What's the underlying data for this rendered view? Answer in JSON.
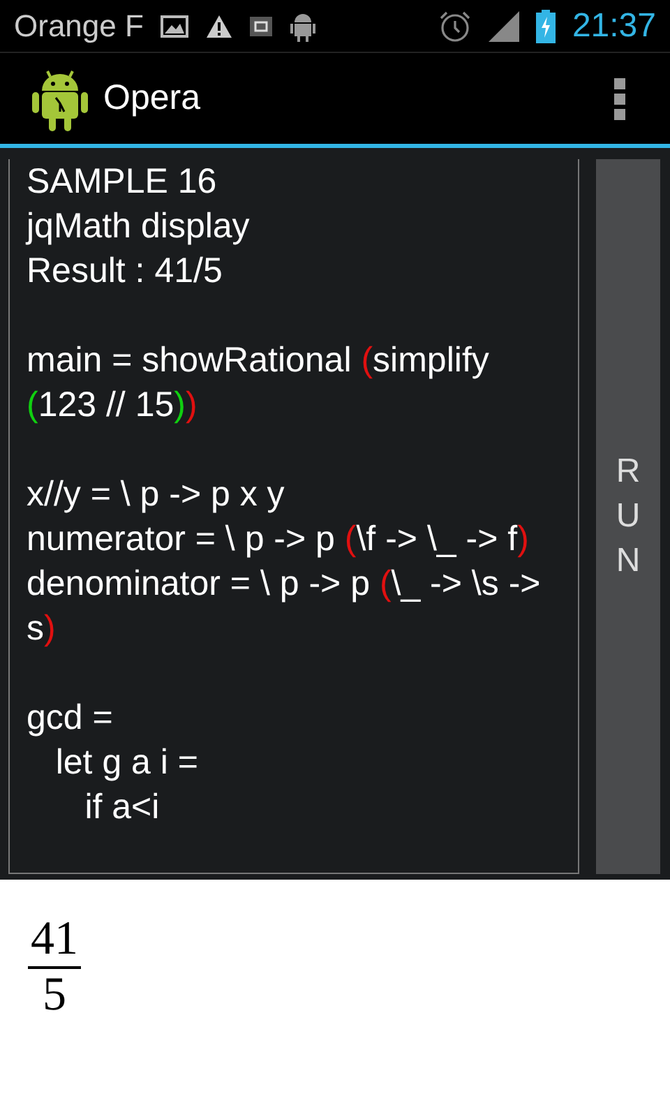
{
  "status_bar": {
    "carrier": "Orange F",
    "time": "21:37"
  },
  "action_bar": {
    "title": "Opera"
  },
  "editor": {
    "blocks": [
      [
        [
          {
            "text": "SAMPLE 16"
          }
        ],
        [
          {
            "text": "jqMath display"
          }
        ],
        [
          {
            "text": "Result : 41/5"
          }
        ]
      ],
      [
        [
          {
            "text": "main = showRational "
          },
          {
            "text": "(",
            "color": "#e01010"
          },
          {
            "text": "simplify "
          },
          {
            "text": "(",
            "color": "#10d010"
          },
          {
            "text": "123 // 15"
          },
          {
            "text": ")",
            "color": "#10d010"
          },
          {
            "text": ")",
            "color": "#e01010"
          }
        ]
      ],
      [
        [
          {
            "text": "x//y = \\ p -> p x y"
          }
        ],
        [
          {
            "text": "numerator = \\ p -> p "
          },
          {
            "text": "(",
            "color": "#e01010"
          },
          {
            "text": "\\f -> \\_ -> f"
          },
          {
            "text": ")",
            "color": "#e01010"
          }
        ],
        [
          {
            "text": "denominator = \\ p -> p "
          },
          {
            "text": "(",
            "color": "#e01010"
          },
          {
            "text": "\\_ -> \\s -> s"
          },
          {
            "text": ")",
            "color": "#e01010"
          }
        ]
      ],
      [
        [
          {
            "text": "gcd ="
          }
        ],
        [
          {
            "text": "   let g a i ="
          }
        ],
        [
          {
            "text": "      if a<i"
          }
        ]
      ]
    ]
  },
  "run_button": {
    "label": "RUN"
  },
  "result": {
    "numerator": "41",
    "denominator": "5"
  }
}
